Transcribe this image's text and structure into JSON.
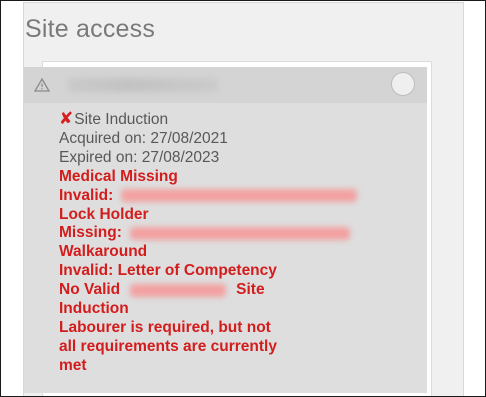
{
  "panel": {
    "title": "Site access"
  },
  "card": {
    "header_icon": "warning-triangle-icon",
    "toggle_icon": "circle-toggle-icon",
    "status_icon": "red-x-icon",
    "lines": {
      "x_mark": "✘",
      "site_induction": "Site Induction",
      "acquired": "Acquired on: 27/08/2021",
      "expired": "Expired on: 27/08/2023",
      "medical_missing": "Medical Missing",
      "invalid_label": "Invalid:",
      "lock_holder": "Lock Holder",
      "missing_label": "Missing:",
      "walkaround": "Walkaround",
      "invalid_letter": "Invalid: Letter of Competency",
      "no_valid": "No Valid",
      "site_word": "Site",
      "induction": "Induction",
      "labourer_1": "Labourer is required, but not",
      "labourer_2": "all requirements are currently",
      "labourer_3": "met"
    }
  },
  "colors": {
    "error_red": "#d31d1d",
    "muted_gray": "#585858",
    "title_gray": "#7a7a7a"
  }
}
